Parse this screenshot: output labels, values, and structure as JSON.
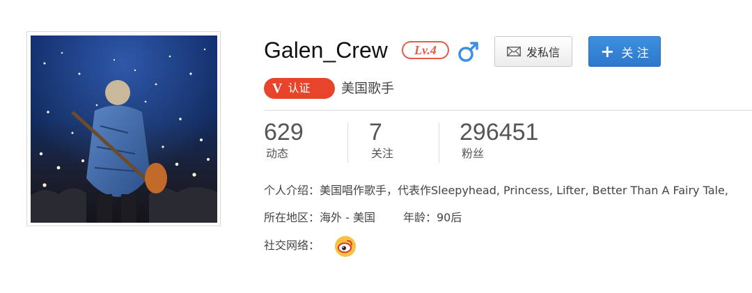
{
  "profile": {
    "username": "Galen_Crew",
    "level": "Lv.4",
    "gender_icon": "male-icon",
    "verified_mark": "V",
    "verified_label": "认证",
    "verified_title": "美国歌手"
  },
  "actions": {
    "message_label": "发私信",
    "follow_plus": "+",
    "follow_label": "关 注"
  },
  "stats": [
    {
      "value": "629",
      "label": "动态"
    },
    {
      "value": "7",
      "label": "关注"
    },
    {
      "value": "296451",
      "label": "粉丝"
    }
  ],
  "info": {
    "intro_label": "个人介绍：",
    "intro_text": "美国唱作歌手，代表作Sleepyhead, Princess, Lifter, Better Than A Fairy Tale,",
    "region_label": "所在地区：",
    "region_value": "海外 - 美国",
    "age_label": "年龄：",
    "age_value": "90后",
    "social_label": "社交网络：",
    "social_icon": "weibo-icon"
  },
  "colors": {
    "accent_blue": "#2d78cc",
    "badge_red": "#e8442c",
    "level_red": "#e45b47",
    "gender_blue": "#3a8ee6"
  }
}
